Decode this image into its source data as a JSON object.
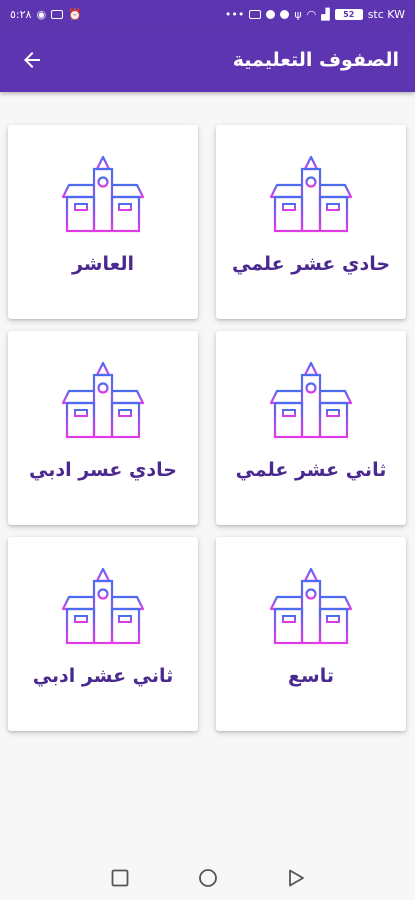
{
  "status_bar": {
    "time": "٥:٢٨",
    "carrier": "stc KW",
    "battery": "52"
  },
  "app_bar": {
    "title": "الصفوف التعليمية",
    "back_icon": "arrow-left-icon"
  },
  "grades": [
    {
      "label": "حادي عشر علمي",
      "icon": "school-building-icon"
    },
    {
      "label": "العاشر",
      "icon": "school-building-icon"
    },
    {
      "label": "ثاني عشر علمي",
      "icon": "school-building-icon"
    },
    {
      "label": "حادي عسر ادبي",
      "icon": "school-building-icon"
    },
    {
      "label": "تاسع",
      "icon": "school-building-icon"
    },
    {
      "label": "ثاني عشر ادبي",
      "icon": "school-building-icon"
    }
  ],
  "nav_bar": {
    "icons": [
      "recents-square-icon",
      "home-circle-icon",
      "back-triangle-icon"
    ]
  },
  "colors": {
    "primary": "#5e35b1",
    "label": "#4b2a8f",
    "icon_gradient_top": "#4a6cf0",
    "icon_gradient_bottom": "#e03ce6"
  }
}
